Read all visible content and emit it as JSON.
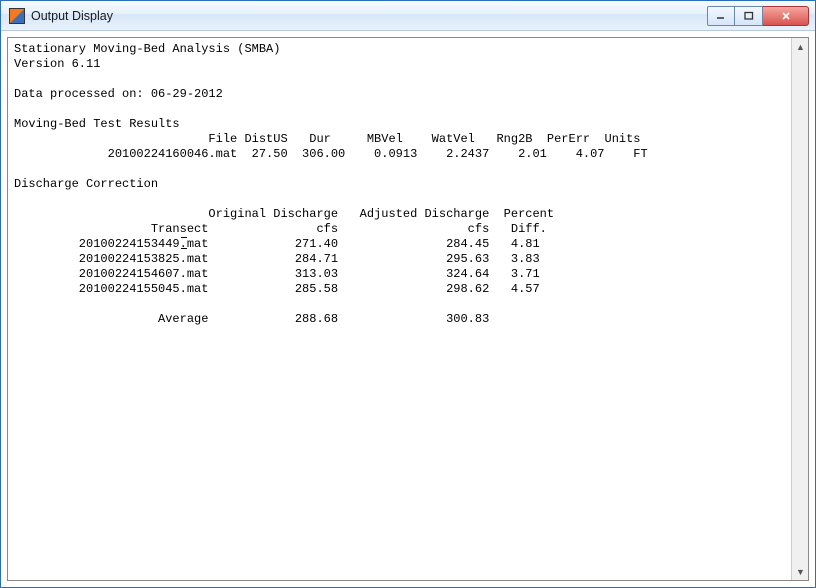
{
  "window": {
    "title": "Output Display"
  },
  "app": {
    "name": "Stationary Moving-Bed Analysis (SMBA)",
    "version_label": "Version 6.11",
    "processed_label": "Data processed on: 06-29-2012"
  },
  "mbt": {
    "heading": "Moving-Bed Test Results",
    "headers": {
      "file": "File",
      "distus": "DistUS",
      "dur": "Dur",
      "mbvel": "MBVel",
      "watvel": "WatVel",
      "rng2b": "Rng2B",
      "pererr": "PerErr",
      "units": "Units"
    },
    "row": {
      "file": "20100224160046.mat",
      "distus": "27.50",
      "dur": "306.00",
      "mbvel": "0.0913",
      "watvel": "2.2437",
      "rng2b": "2.01",
      "pererr": "4.07",
      "units": "FT"
    }
  },
  "disc": {
    "heading": "Discharge Correction",
    "headers": {
      "orig": "Original Discharge",
      "adj": "Adjusted Discharge",
      "pct": "Percent",
      "transect": "Transect",
      "cfs1": "cfs",
      "cfs2": "cfs",
      "diff": "Diff."
    },
    "rows": [
      {
        "transect": "20100224153449.mat",
        "orig": "271.40",
        "adj": "284.45",
        "pct": "4.81"
      },
      {
        "transect": "20100224153825.mat",
        "orig": "284.71",
        "adj": "295.63",
        "pct": "3.83"
      },
      {
        "transect": "20100224154607.mat",
        "orig": "313.03",
        "adj": "324.64",
        "pct": "3.71"
      },
      {
        "transect": "20100224155045.mat",
        "orig": "285.58",
        "adj": "298.62",
        "pct": "4.57"
      }
    ],
    "average": {
      "label": "Average",
      "orig": "288.68",
      "adj": "300.83"
    }
  }
}
